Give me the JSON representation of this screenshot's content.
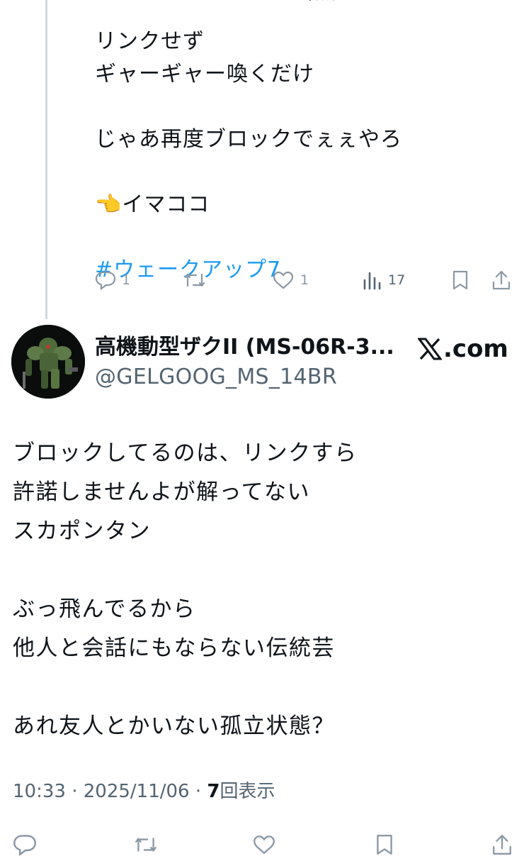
{
  "previous_tweet": {
    "cut_line": "リンクさせないから当然",
    "lines": [
      "リンクせず",
      "ギャーギャー喚くだけ",
      "",
      "じゃあ再度ブロックでぇぇやろ",
      "",
      "👈イマココ",
      ""
    ],
    "hashtag": "#ウェークアップ7",
    "actions": {
      "reply_count": "1",
      "retweet_count": "",
      "like_count": "1",
      "views_count": "17"
    }
  },
  "main_tweet": {
    "display_name": "高機動型ザクII (MS-06R-3...",
    "handle": "@GELGOOG_MS_14BR",
    "source_logo_text": ".com",
    "lines": [
      "ブロックしてるのは、リンクすら",
      "許諾しませんよが解ってない",
      "スカポンタン",
      "",
      "ぶっ飛んでるから",
      "他人と会話にもならない伝統芸",
      "",
      "あれ友人とかいない孤立状態？"
    ],
    "time": "10:33",
    "separator": "·",
    "date": "2025/11/06",
    "views_count": "7",
    "views_label": "回表示"
  },
  "colors": {
    "link": "#1d9bf0",
    "secondary_text": "#536471",
    "icon": "#8b98a5",
    "thread_line": "#cfd9de"
  },
  "icons": [
    "reply-icon",
    "retweet-icon",
    "like-icon",
    "views-icon",
    "bookmark-icon",
    "share-icon",
    "x-logo-icon"
  ]
}
